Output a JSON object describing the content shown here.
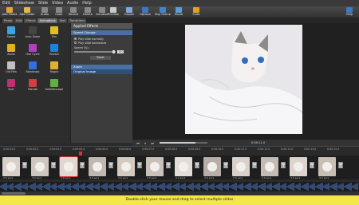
{
  "menu": [
    "Edit",
    "Slideshow",
    "Slide",
    "Video",
    "Audio",
    "Help"
  ],
  "toolbar": [
    {
      "label": "Add Media",
      "icon": "folder-icon",
      "color": "#e2a53a"
    },
    {
      "label": "Add Folder",
      "icon": "folder-plus-icon",
      "color": "#e2b84a"
    },
    {
      "label": "Audio",
      "icon": "audio-icon",
      "color": "#888"
    },
    {
      "label": "Color",
      "icon": "color-icon",
      "color": "#888"
    },
    {
      "label": "Record",
      "icon": "record-icon",
      "color": "#888"
    },
    {
      "label": "Delete",
      "icon": "delete-icon",
      "color": "#888"
    },
    {
      "label": "Duration",
      "icon": "duration-icon",
      "color": "#888"
    },
    {
      "label": "Preview",
      "icon": "preview-icon",
      "color": "#c9c9c9"
    },
    {
      "label": "Export",
      "icon": "export-icon",
      "color": "#7fa7d6"
    },
    {
      "label": "Options",
      "icon": "options-icon",
      "color": "#3c78c8"
    },
    {
      "label": "Buy Online",
      "icon": "cart-icon",
      "color": "#3a87d0"
    },
    {
      "label": "Share",
      "icon": "share-icon",
      "color": "#5a9be0"
    },
    {
      "label": "Suite",
      "icon": "suite-icon",
      "color": "#e0a020"
    },
    {
      "label": "Help",
      "icon": "help-icon",
      "color": "#3c78c8"
    }
  ],
  "tabs": [
    "Photo",
    "Edit",
    "Effects",
    "Animations",
    "Text",
    "Transitions"
  ],
  "active_tab": "Animations",
  "effects": [
    {
      "label": "Speed",
      "icon": "speed-effect-icon",
      "color": "#3ea3e0"
    },
    {
      "label": "Auto Zoom",
      "icon": "auto-zoom-icon",
      "color": "#444"
    },
    {
      "label": "Pan",
      "icon": "pan-icon",
      "color": "#e0c020"
    },
    {
      "label": "Zoom",
      "icon": "zoom-effect-icon",
      "color": "#e0b020"
    },
    {
      "label": "Hue Cycle",
      "icon": "hue-cycle-icon",
      "color": "#b040c0"
    },
    {
      "label": "Reveal",
      "icon": "reveal-icon",
      "color": "#2080e0"
    },
    {
      "label": "Old Film",
      "icon": "old-film-icon",
      "color": "#c0c0c0"
    },
    {
      "label": "Raindrops",
      "icon": "raindrops-icon",
      "color": "#3070e0"
    },
    {
      "label": "Ripple",
      "icon": "ripple-icon",
      "color": "#e0b030"
    },
    {
      "label": "Spin",
      "icon": "spin-icon",
      "color": "#c03070"
    },
    {
      "label": "Vibrate",
      "icon": "vibrate-icon",
      "color": "#d04040"
    },
    {
      "label": "Kaleidoscope",
      "icon": "kaleidoscope-icon",
      "color": "#60b040"
    }
  ],
  "applied": {
    "title": "Applied Effects",
    "section": "Speed Change",
    "option1": "Play slide normally",
    "option2": "Play slide backwards",
    "speed_label": "Speed (%):",
    "speed_value": "100",
    "reset": "Reset",
    "section2": "Zoom",
    "section3": "Original Image"
  },
  "timeline_ticks": [
    "0:00:01.0",
    "0:00:02.0",
    "0:00:03.0",
    "0:00:04.0",
    "0:00:05.0",
    "0:00:06.0",
    "0:00:07.0",
    "0:00:08.0",
    "0:00:09.0",
    "0:00:10.0",
    "0:00:11.0",
    "0:00:12.0",
    "0:00:13.0",
    "0:00:14.0",
    "0:00:15.0"
  ],
  "preview_time": "0:00:11.0",
  "clip_durations": [
    "3.0 secs",
    "3.0 secs",
    "3.0 secs",
    "3.0 secs",
    "3.0 secs",
    "3.0 secs",
    "3.0 secs",
    "3.0 secs",
    "3.0 secs",
    "3.0 secs",
    "3.0 secs",
    "3.0 secs"
  ],
  "transition_duration": "1.0",
  "status": "Double-click your mouse and drag to select multiple slides"
}
